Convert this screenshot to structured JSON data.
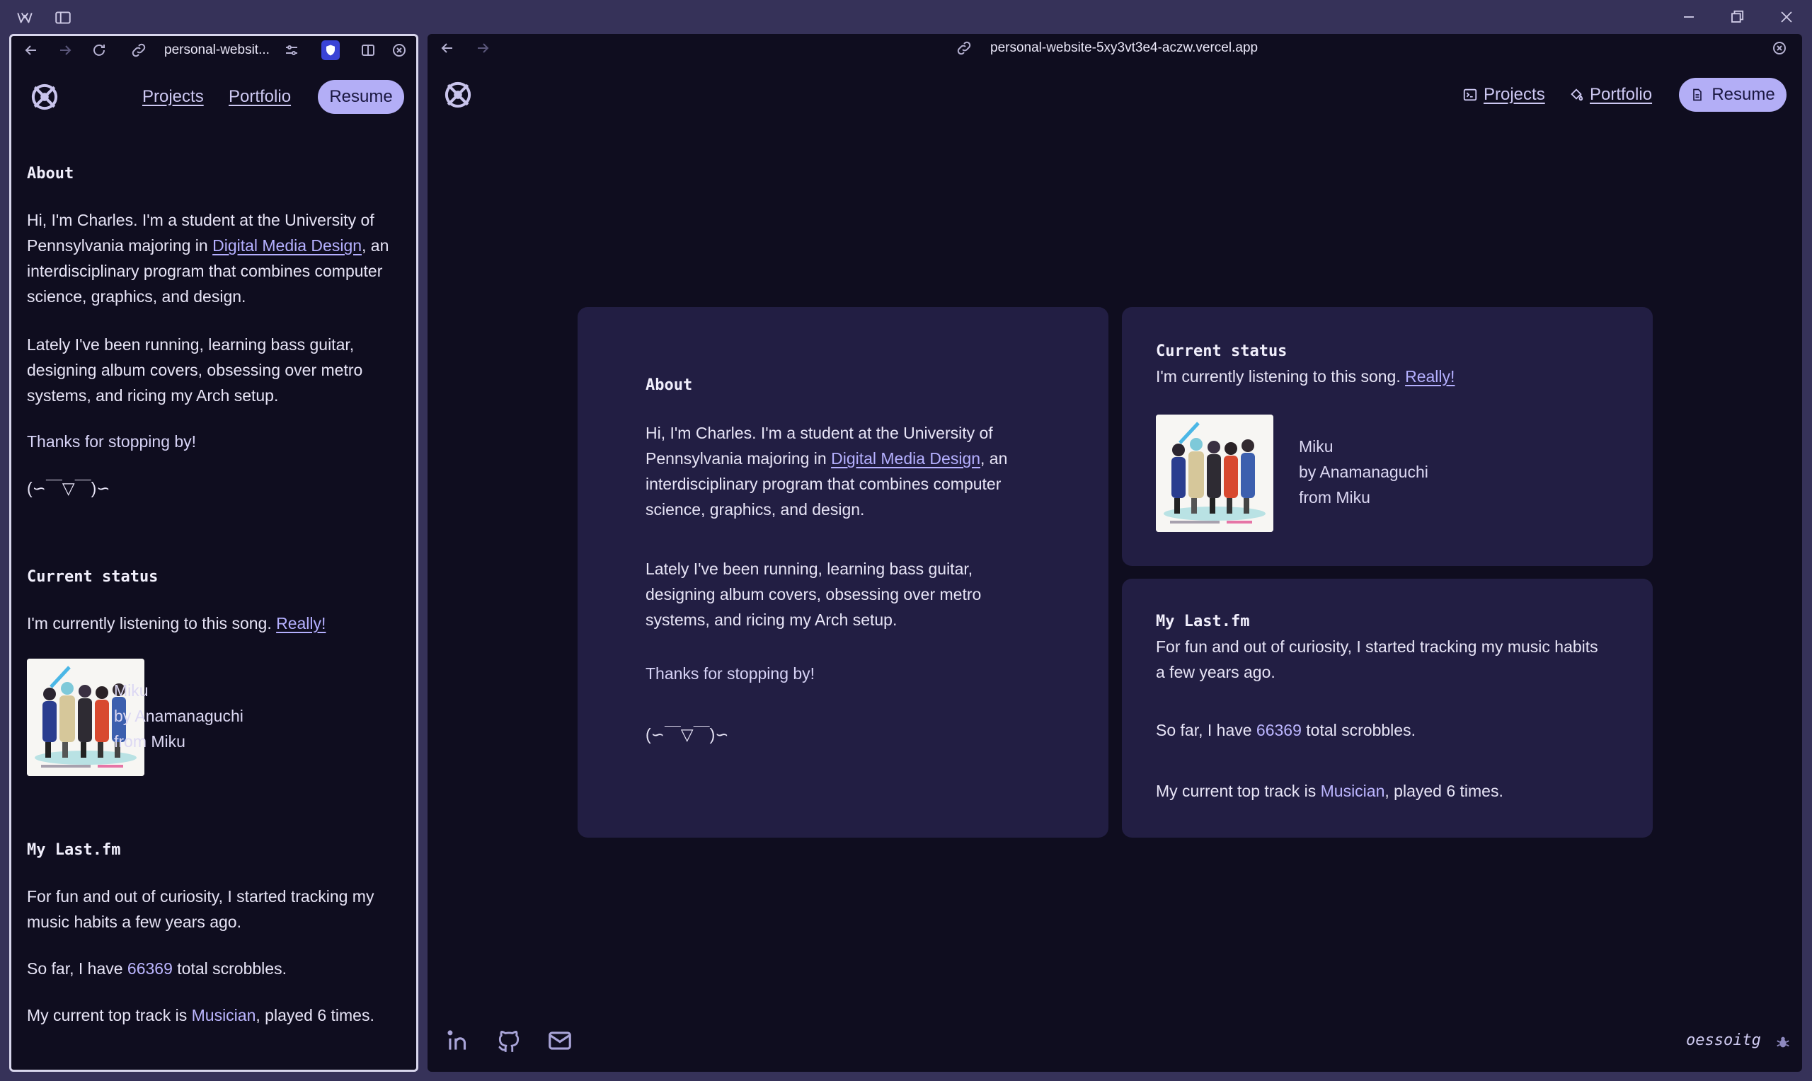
{
  "left_tab": {
    "url": "personal-websit..."
  },
  "right_tab": {
    "url": "personal-website-5xy3vt3e4-aczw.vercel.app"
  },
  "nav": {
    "projects": "Projects",
    "portfolio": "Portfolio",
    "resume": "Resume"
  },
  "about": {
    "heading": "About",
    "p1_a": "Hi, I'm Charles. I'm a student at the University of Pennsylvania majoring in ",
    "p1_link": "Digital Media Design",
    "p1_b": ", an interdisciplinary program that combines computer science, graphics, and design.",
    "p2": "Lately I've been running, learning bass guitar, designing album covers, obsessing over metro systems, and ricing my Arch setup.",
    "p3": "Thanks for stopping by!",
    "kaomoji": "(∽￣▽￣)∽"
  },
  "status": {
    "heading": "Current status",
    "text": "I'm currently listening to this song. ",
    "link": "Really!",
    "track": "Miku",
    "artist_prefix": "by ",
    "artist": "Anamanaguchi",
    "album_prefix": "from ",
    "album": "Miku"
  },
  "lastfm": {
    "heading": "My Last.fm",
    "p1": "For fun and out of curiosity, I started tracking my music habits a few years ago.",
    "p2_a": "So far, I have ",
    "scrobbles": "66369",
    "p2_b": " total scrobbles.",
    "p3_a": "My current top track is ",
    "top_track": "Musician",
    "p3_b": ", played 6 times."
  },
  "footer": {
    "signature": "oessoitg"
  },
  "colors": {
    "page_bg": "#0f0d1f",
    "card_bg": "#221e43",
    "accent": "#b3aef6",
    "link": "#b5b0ff",
    "chrome": "#363259"
  }
}
